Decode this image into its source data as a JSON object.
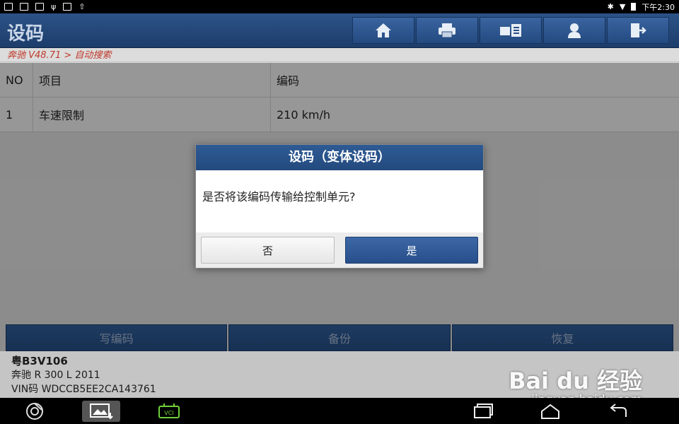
{
  "status_bar": {
    "time": "下午2:30"
  },
  "header": {
    "title": "设码"
  },
  "toolbar": [
    {
      "icon": "home-icon"
    },
    {
      "icon": "print-icon"
    },
    {
      "icon": "diagnostic-icon"
    },
    {
      "icon": "user-icon"
    },
    {
      "icon": "exit-icon"
    }
  ],
  "breadcrumb": {
    "text": "奔驰 V48.71 > 自动搜索"
  },
  "table": {
    "headers": [
      "NO",
      "项目",
      "编码"
    ],
    "rows": [
      [
        "1",
        "车速限制",
        "210 km/h"
      ]
    ]
  },
  "dialog": {
    "title": "设码（变体设码）",
    "message": "是否将该编码传输给控制单元?",
    "no_label": "否",
    "yes_label": "是"
  },
  "actions": {
    "write": "写编码",
    "backup": "备份",
    "restore": "恢复"
  },
  "vehicle": {
    "plate": "粤B3V106",
    "model": "奔驰 R 300 L 2011",
    "vin": "VIN码 WDCCB5EE2CA143761"
  },
  "watermark": {
    "brand": "Bai du 经验",
    "url": "jingyan.baidu.com"
  }
}
